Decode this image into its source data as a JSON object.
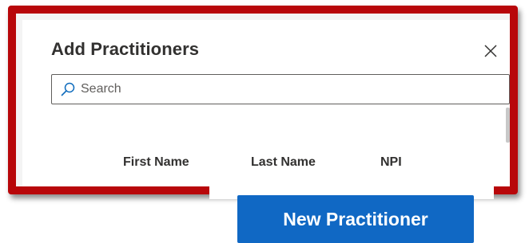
{
  "dialog": {
    "title": "Add Practitioners",
    "close_icon": "close-icon"
  },
  "search": {
    "icon": "search-icon",
    "placeholder": "Search",
    "value": ""
  },
  "table": {
    "columns": [
      "First Name",
      "Last Name",
      "NPI"
    ],
    "rows": []
  },
  "actions": {
    "new_practitioner_label": "New Practitioner"
  },
  "colors": {
    "highlight_border": "#b8070a",
    "primary_button": "#1068c4",
    "text": "#323130"
  }
}
